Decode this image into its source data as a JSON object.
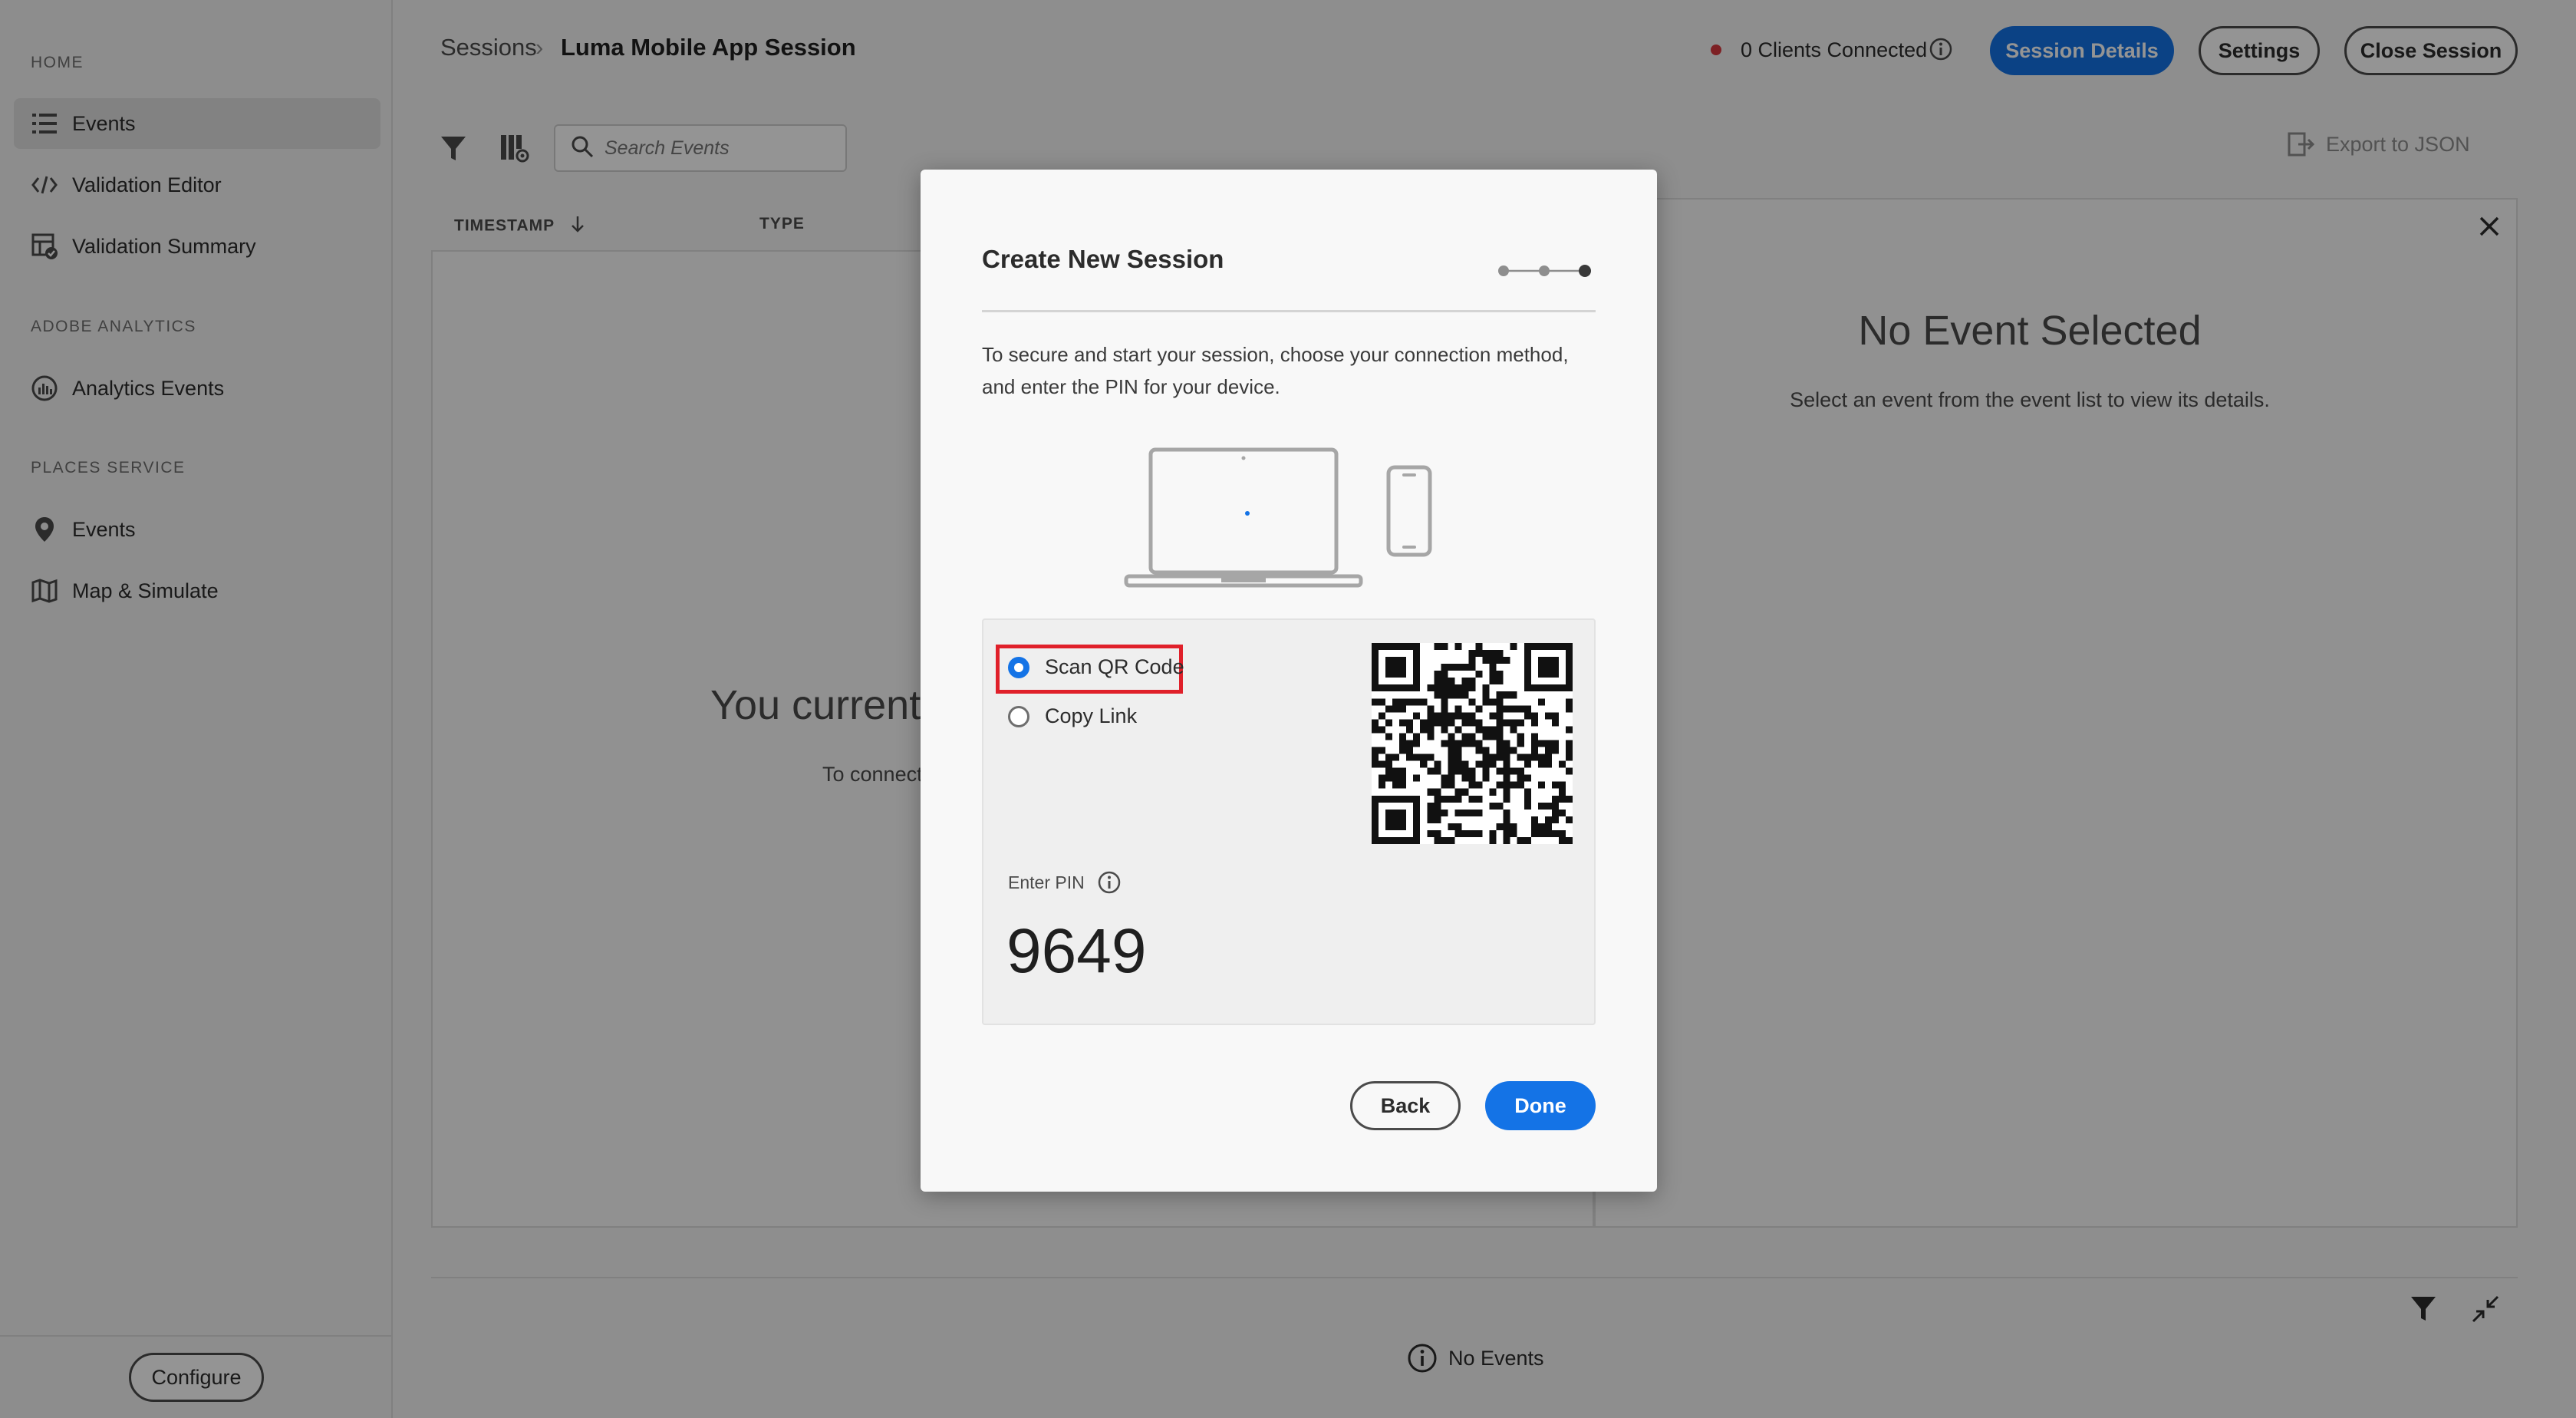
{
  "sidebar": {
    "sections": [
      {
        "title": "HOME",
        "items": [
          {
            "label": "Events",
            "icon": "list-icon",
            "active": true
          },
          {
            "label": "Validation Editor",
            "icon": "code-icon"
          },
          {
            "label": "Validation Summary",
            "icon": "validation-summary-icon"
          }
        ]
      },
      {
        "title": "ADOBE ANALYTICS",
        "items": [
          {
            "label": "Analytics Events",
            "icon": "analytics-icon"
          }
        ]
      },
      {
        "title": "PLACES SERVICE",
        "items": [
          {
            "label": "Events",
            "icon": "location-pin-icon"
          },
          {
            "label": "Map & Simulate",
            "icon": "map-icon"
          }
        ]
      }
    ],
    "configure_label": "Configure"
  },
  "header": {
    "breadcrumb_root": "Sessions",
    "breadcrumb_separator": "›",
    "breadcrumb_current": "Luma Mobile App Session",
    "clients_status": "0 Clients Connected",
    "status_color": "#d7373f",
    "session_details_label": "Session Details",
    "settings_label": "Settings",
    "close_session_label": "Close Session"
  },
  "toolbar": {
    "search_placeholder": "Search Events",
    "export_label": "Export to JSON"
  },
  "table": {
    "col_timestamp": "TIMESTAMP",
    "col_type": "TYPE",
    "empty_title": "You currently",
    "empty_sub": "To connect"
  },
  "detail": {
    "title": "No Event Selected",
    "subtitle": "Select an event from the event list to view its details."
  },
  "footer": {
    "status": "No Events"
  },
  "modal": {
    "title": "Create New Session",
    "steps": 3,
    "current_step": 3,
    "description": "To secure and start your session, choose your connection method, and enter the PIN for your device.",
    "options": [
      {
        "label": "Scan QR Code",
        "selected": true
      },
      {
        "label": "Copy Link",
        "selected": false
      }
    ],
    "pin_label": "Enter PIN",
    "pin_value": "9649",
    "back_label": "Back",
    "done_label": "Done",
    "accent_color": "#1473e6",
    "highlight_color": "#e0202a"
  }
}
